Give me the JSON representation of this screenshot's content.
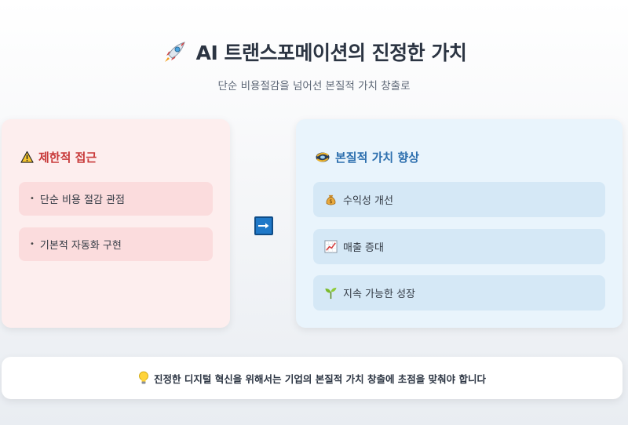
{
  "header": {
    "title": "AI 트랜스포메이션의 진정한 가치",
    "subtitle": "단순 비용절감을 넘어선 본질적 가치 창출로"
  },
  "left_card": {
    "heading": "제한적 접근",
    "items": [
      {
        "bullet": "•",
        "label": "단순 비용 절감 관점"
      },
      {
        "bullet": "•",
        "label": "기본적 자동화 구현"
      }
    ]
  },
  "right_card": {
    "heading": "본질적 가치 향상",
    "items": [
      {
        "icon": "money-bag-icon",
        "label": "수익성 개선"
      },
      {
        "icon": "chart-up-icon",
        "label": "매출 증대"
      },
      {
        "icon": "seedling-icon",
        "label": "지속 가능한 성장"
      }
    ]
  },
  "footer": {
    "text": "진정한 디지털 혁신을 위해서는 기업의 본질적 가치 창출에 초점을 맞춰야 합니다"
  },
  "colors": {
    "left_accent": "#c83a3a",
    "right_accent": "#2d6fae",
    "arrow": "#1f78c8"
  }
}
